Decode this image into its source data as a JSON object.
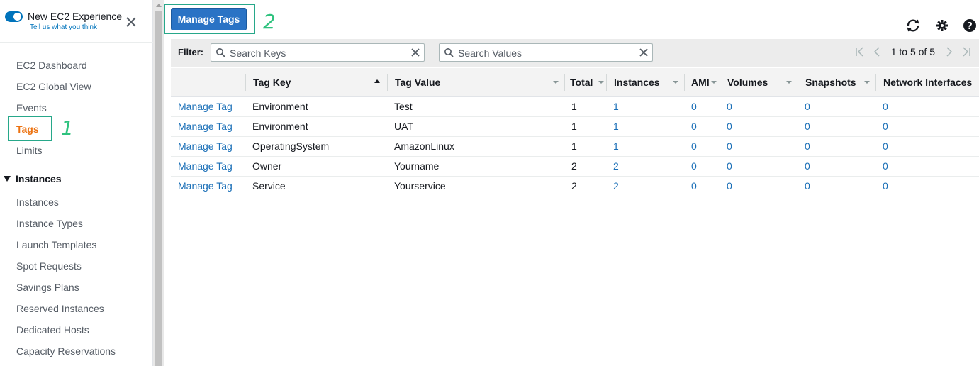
{
  "sidebar": {
    "experience_title": "New EC2 Experience",
    "experience_sub": "Tell us what you think",
    "items": [
      {
        "label": "EC2 Dashboard"
      },
      {
        "label": "EC2 Global View"
      },
      {
        "label": "Events"
      },
      {
        "label": "Tags"
      },
      {
        "label": "Limits"
      }
    ],
    "section_title": "Instances",
    "section_items": [
      {
        "label": "Instances"
      },
      {
        "label": "Instance Types"
      },
      {
        "label": "Launch Templates"
      },
      {
        "label": "Spot Requests"
      },
      {
        "label": "Savings Plans"
      },
      {
        "label": "Reserved Instances"
      },
      {
        "label": "Dedicated Hosts"
      },
      {
        "label": "Capacity Reservations"
      }
    ]
  },
  "annotations": {
    "one": "1",
    "two": "2"
  },
  "toolbar": {
    "manage_tags_label": "Manage Tags"
  },
  "filter": {
    "label": "Filter:",
    "keys_placeholder": "Search Keys",
    "values_placeholder": "Search Values",
    "pagination": "1 to 5 of 5"
  },
  "table": {
    "headers": [
      "Tag Key",
      "Tag Value",
      "Total",
      "Instances",
      "AMI",
      "Volumes",
      "Snapshots",
      "Network Interfaces"
    ],
    "rows": [
      {
        "action": "Manage Tag",
        "key": "Environment",
        "value": "Test",
        "total": "1",
        "instances": "1",
        "ami": "0",
        "volumes": "0",
        "snapshots": "0",
        "eni": "0"
      },
      {
        "action": "Manage Tag",
        "key": "Environment",
        "value": "UAT",
        "total": "1",
        "instances": "1",
        "ami": "0",
        "volumes": "0",
        "snapshots": "0",
        "eni": "0"
      },
      {
        "action": "Manage Tag",
        "key": "OperatingSystem",
        "value": "AmazonLinux",
        "total": "1",
        "instances": "1",
        "ami": "0",
        "volumes": "0",
        "snapshots": "0",
        "eni": "0"
      },
      {
        "action": "Manage Tag",
        "key": "Owner",
        "value": "Yourname",
        "total": "2",
        "instances": "2",
        "ami": "0",
        "volumes": "0",
        "snapshots": "0",
        "eni": "0"
      },
      {
        "action": "Manage Tag",
        "key": "Service",
        "value": "Yourservice",
        "total": "2",
        "instances": "2",
        "ami": "0",
        "volumes": "0",
        "snapshots": "0",
        "eni": "0"
      }
    ]
  },
  "colors": {
    "accent": "#2a73c5",
    "active_nav": "#ec7211",
    "link": "#1a6fb7",
    "annotation": "#2ec27e"
  }
}
